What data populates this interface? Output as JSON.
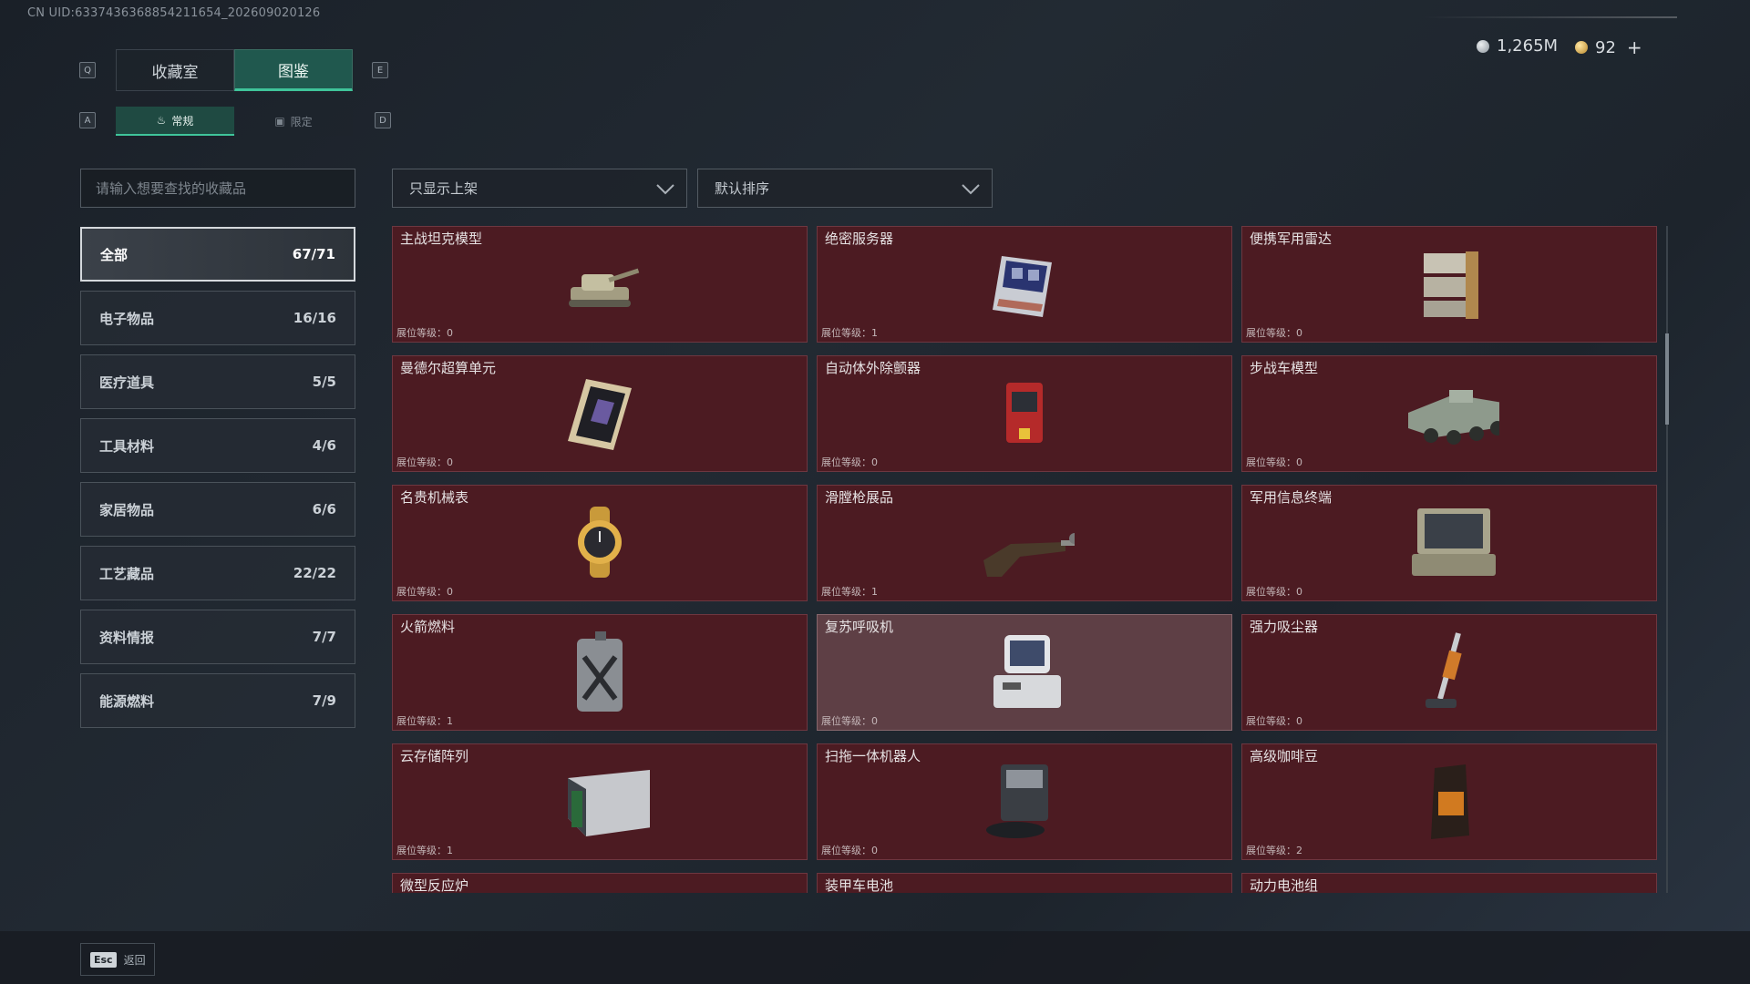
{
  "header": {
    "uid": "CN UID:6337436368854211654_202609020126",
    "currency_silver": "1,265M",
    "currency_gold": "92",
    "plus": "+"
  },
  "tabs": {
    "left_key": "Q",
    "right_key": "E",
    "collection": "收藏室",
    "codex": "图鉴",
    "subtab_left_key": "A",
    "subtab_right_key": "D",
    "regular": "常规",
    "limited": "限定"
  },
  "search": {
    "placeholder": "请输入想要查找的收藏品"
  },
  "filters": {
    "show": "只显示上架",
    "sort": "默认排序"
  },
  "categories": [
    {
      "label": "全部",
      "count": "67/71"
    },
    {
      "label": "电子物品",
      "count": "16/16"
    },
    {
      "label": "医疗道具",
      "count": "5/5"
    },
    {
      "label": "工具材料",
      "count": "4/6"
    },
    {
      "label": "家居物品",
      "count": "6/6"
    },
    {
      "label": "工艺藏品",
      "count": "22/22"
    },
    {
      "label": "资料情报",
      "count": "7/7"
    },
    {
      "label": "能源燃料",
      "count": "7/9"
    }
  ],
  "level_prefix": "展位等级：",
  "items": [
    {
      "name": "主战坦克模型",
      "level": "展位等级：0",
      "icon": "tank-icon"
    },
    {
      "name": "绝密服务器",
      "level": "展位等级：1",
      "icon": "server-icon"
    },
    {
      "name": "便携军用雷达",
      "level": "展位等级：0",
      "icon": "radar-icon"
    },
    {
      "name": "曼德尔超算单元",
      "level": "展位等级：0",
      "icon": "supercomputer-icon"
    },
    {
      "name": "自动体外除颤器",
      "level": "展位等级：0",
      "icon": "defibrillator-icon"
    },
    {
      "name": "步战车模型",
      "level": "展位等级：0",
      "icon": "ifv-icon"
    },
    {
      "name": "名贵机械表",
      "level": "展位等级：0",
      "icon": "watch-icon"
    },
    {
      "name": "滑膛枪展品",
      "level": "展位等级：1",
      "icon": "musket-icon"
    },
    {
      "name": "军用信息终端",
      "level": "展位等级：0",
      "icon": "terminal-icon"
    },
    {
      "name": "火箭燃料",
      "level": "展位等级：1",
      "icon": "fuel-can-icon"
    },
    {
      "name": "复苏呼吸机",
      "level": "展位等级：0",
      "icon": "ventilator-icon"
    },
    {
      "name": "强力吸尘器",
      "level": "展位等级：0",
      "icon": "vacuum-icon"
    },
    {
      "name": "云存储阵列",
      "level": "展位等级：1",
      "icon": "storage-array-icon"
    },
    {
      "name": "扫拖一体机器人",
      "level": "展位等级：0",
      "icon": "robot-mop-icon"
    },
    {
      "name": "高级咖啡豆",
      "level": "展位等级：2",
      "icon": "coffee-bag-icon"
    },
    {
      "name": "微型反应炉",
      "level": "",
      "icon": "reactor-icon"
    },
    {
      "name": "装甲车电池",
      "level": "",
      "icon": "battery-icon"
    },
    {
      "name": "动力电池组",
      "level": "",
      "icon": "battery-pack-icon"
    }
  ],
  "footer": {
    "esc": "Esc",
    "back": "返回"
  },
  "colors": {
    "accent": "#3fc49a",
    "card_bg": "#4c1b22",
    "card_highlight": "#5e3f45"
  }
}
